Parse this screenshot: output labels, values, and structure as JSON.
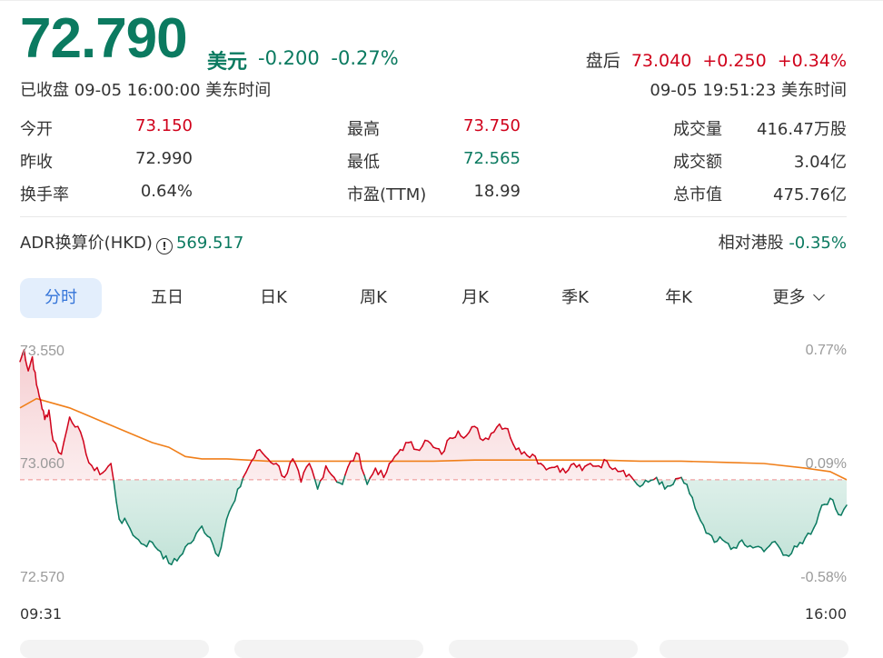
{
  "quote": {
    "price": "72.790",
    "currency": "美元",
    "change": "-0.200",
    "change_pct": "-0.27%",
    "status": "已收盘 09-05 16:00:00 美东时间",
    "after_hours": {
      "label": "盘后",
      "price": "73.040",
      "change": "+0.250",
      "change_pct": "+0.34%",
      "time": "09-05 19:51:23 美东时间"
    }
  },
  "stats": [
    [
      {
        "label": "今开",
        "value": "73.150",
        "tone": "up"
      },
      {
        "label": "昨收",
        "value": "72.990",
        "tone": "neutral"
      },
      {
        "label": "换手率",
        "value": "0.64%",
        "tone": "neutral"
      }
    ],
    [
      {
        "label": "最高",
        "value": "73.750",
        "tone": "up"
      },
      {
        "label": "最低",
        "value": "72.565",
        "tone": "down"
      },
      {
        "label": "市盈(TTM)",
        "value": "18.99",
        "tone": "neutral"
      }
    ],
    [
      {
        "label": "成交量",
        "value": "416.47万股",
        "tone": "neutral"
      },
      {
        "label": "成交额",
        "value": "3.04亿",
        "tone": "neutral"
      },
      {
        "label": "总市值",
        "value": "475.76亿",
        "tone": "neutral"
      }
    ]
  ],
  "adr": {
    "label": "ADR换算价(HKD)",
    "info_icon": "info-icon",
    "value": "569.517"
  },
  "relative_hk": {
    "label": "相对港股",
    "value": "-0.35%"
  },
  "tabs": [
    "分时",
    "五日",
    "日K",
    "周K",
    "月K",
    "季K",
    "年K",
    "更多"
  ],
  "active_tab": 0,
  "colors": {
    "up": "#d0021b",
    "down": "#0b7a60",
    "avg_line": "#f07f1a",
    "accent": "#3575d9",
    "neutral": "#333333"
  },
  "chart_data": {
    "type": "line",
    "title": "",
    "x_labels": [
      "09:31",
      "16:00"
    ],
    "y_labels_left": [
      "73.550",
      "73.060",
      "72.570"
    ],
    "y_labels_right": [
      "0.77%",
      "0.09%",
      "-0.58%"
    ],
    "ylim": [
      72.57,
      73.55
    ],
    "prev_close": 72.99,
    "x_range": [
      0,
      100
    ],
    "series": [
      {
        "role": "price",
        "x": [
          0,
          0.5,
          1,
          1.5,
          2,
          2.5,
          3,
          3.5,
          4,
          5,
          6,
          7,
          8,
          9,
          10,
          11,
          12,
          13,
          14,
          15,
          16,
          17,
          18,
          19,
          20,
          21,
          22,
          23,
          24,
          25,
          26,
          27,
          28,
          29,
          30,
          31,
          32,
          33,
          34,
          35,
          36,
          37,
          38,
          39,
          40,
          41,
          42,
          43,
          44,
          45,
          46,
          47,
          48,
          49,
          50,
          51,
          52,
          53,
          54,
          55,
          56,
          57,
          58,
          59,
          60,
          61,
          62,
          63,
          64,
          65,
          66,
          67,
          68,
          69,
          70,
          71,
          72,
          73,
          74,
          75,
          76,
          77,
          78,
          79,
          80,
          81,
          82,
          83,
          84,
          85,
          86,
          87,
          88,
          89,
          90,
          91,
          92,
          93,
          94,
          95,
          96,
          97,
          98,
          99,
          100
        ],
        "values": [
          73.5,
          73.55,
          73.46,
          73.52,
          73.4,
          73.33,
          73.25,
          73.29,
          73.16,
          73.1,
          73.26,
          73.22,
          73.1,
          73.03,
          73.02,
          73.06,
          72.82,
          72.8,
          72.74,
          72.71,
          72.72,
          72.68,
          72.63,
          72.64,
          72.7,
          72.73,
          72.79,
          72.74,
          72.66,
          72.82,
          72.9,
          73.0,
          73.07,
          73.12,
          73.08,
          73.06,
          73.0,
          73.08,
          72.98,
          73.06,
          72.95,
          73.05,
          73.0,
          72.97,
          73.07,
          73.1,
          72.97,
          73.04,
          73.0,
          73.07,
          73.12,
          73.15,
          73.12,
          73.16,
          73.13,
          73.1,
          73.17,
          73.2,
          73.18,
          73.22,
          73.16,
          73.19,
          73.23,
          73.21,
          73.12,
          73.11,
          73.1,
          73.06,
          73.04,
          73.05,
          73.02,
          73.06,
          73.03,
          73.06,
          73.05,
          73.07,
          73.04,
          73.03,
          73.0,
          72.96,
          72.98,
          73.0,
          72.95,
          72.97,
          73.0,
          72.93,
          72.84,
          72.76,
          72.72,
          72.73,
          72.69,
          72.72,
          72.7,
          72.7,
          72.68,
          72.72,
          72.69,
          72.66,
          72.7,
          72.74,
          72.78,
          72.88,
          72.91,
          72.84,
          72.88
        ]
      },
      {
        "role": "average",
        "x": [
          0,
          2,
          4,
          6,
          8,
          10,
          12,
          14,
          16,
          18,
          20,
          22,
          25,
          30,
          35,
          40,
          45,
          50,
          55,
          60,
          65,
          70,
          75,
          80,
          85,
          90,
          95,
          98,
          100
        ],
        "values": [
          73.3,
          73.34,
          73.32,
          73.3,
          73.27,
          73.24,
          73.21,
          73.18,
          73.15,
          73.13,
          73.09,
          73.08,
          73.08,
          73.07,
          73.07,
          73.07,
          73.07,
          73.07,
          73.075,
          73.075,
          73.075,
          73.075,
          73.07,
          73.07,
          73.065,
          73.06,
          73.04,
          73.025,
          72.99
        ]
      }
    ]
  },
  "bottom_cards": 4
}
